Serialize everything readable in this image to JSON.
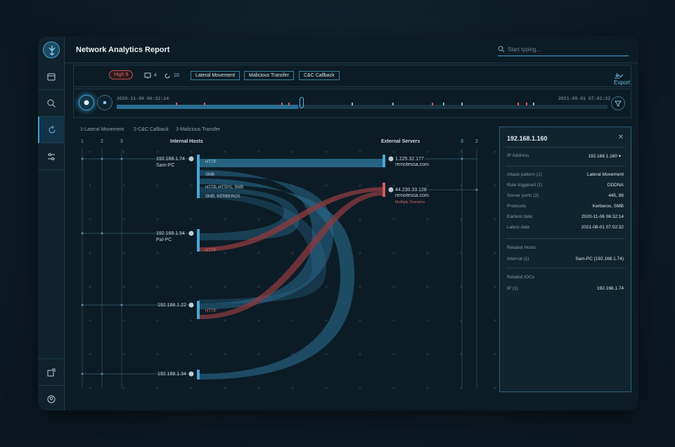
{
  "app": {
    "title": "Network Analytics Report"
  },
  "search": {
    "placeholder": "Start typing..."
  },
  "filters": {
    "severity": "High 9",
    "devices_count": "4",
    "sync_count": "10",
    "tags": [
      "Lateral Movement",
      "Malicious Transfer",
      "C&C Callback"
    ],
    "export_label": "Export"
  },
  "timeline": {
    "start": "2020-11-06 06:32:14",
    "end": "2021-08-01 07:02:32",
    "progress": 0.37
  },
  "legend": [
    "1-Lateral Movement",
    "2-C&C Callback",
    "3-Malicious Transfer"
  ],
  "graph": {
    "internal_header": "Internal Hosts",
    "external_header": "External Servers",
    "left_cols": [
      "1",
      "2",
      "3"
    ],
    "right_cols": [
      "3",
      "2"
    ],
    "hosts": [
      {
        "ip": "192.168.1.74",
        "name": "Sam-PC",
        "protocols": [
          "HTTP",
          "SMB",
          "HTTP, HTTPS, SMB",
          "SMB, KERBEROS"
        ]
      },
      {
        "ip": "192.168.1.54",
        "name": "Pal-PC",
        "protocols": [
          "HTTP"
        ]
      },
      {
        "ip": "192.168.1.22",
        "name": "",
        "protocols": [
          "HTTP"
        ]
      },
      {
        "ip": "192.168.1.34",
        "name": "",
        "protocols": []
      }
    ],
    "servers": [
      {
        "ip": "1.225.32.177",
        "domain": "remotessa.com",
        "note": ""
      },
      {
        "ip": "44.230.33.128",
        "domain": "remotessa.com",
        "note": "Multiple Domains"
      }
    ]
  },
  "detail": {
    "title": "192.168.1.160",
    "ip_label": "IP Address",
    "ip_value": "192.168.1.160",
    "rows": [
      {
        "label": "Attack pattern (1)",
        "value": "Lateral Movement"
      },
      {
        "label": "Rule triggered (1)",
        "value": "DDDNA"
      },
      {
        "label": "Server ports (2)",
        "value": "445, 88"
      },
      {
        "label": "Protocols",
        "value": "Kerberos, SMB"
      },
      {
        "label": "Earliest date",
        "value": "2020-11-06 06:32:14"
      },
      {
        "label": "Latest date",
        "value": "2021-08-01 07:02:32"
      }
    ],
    "related_hosts": "Related Hosts",
    "internal_label": "Internal (1)",
    "internal_value": "Sam-PC (192.168.1.74)",
    "related_iocs": "Related IOCs",
    "ioc_label": "IP (1)",
    "ioc_value": "192.168.1.74"
  },
  "colors": {
    "accent": "#3ea0d2",
    "danger": "#c0504f",
    "flow_blue": "#2b6e92",
    "flow_red": "#8a3a3f"
  }
}
